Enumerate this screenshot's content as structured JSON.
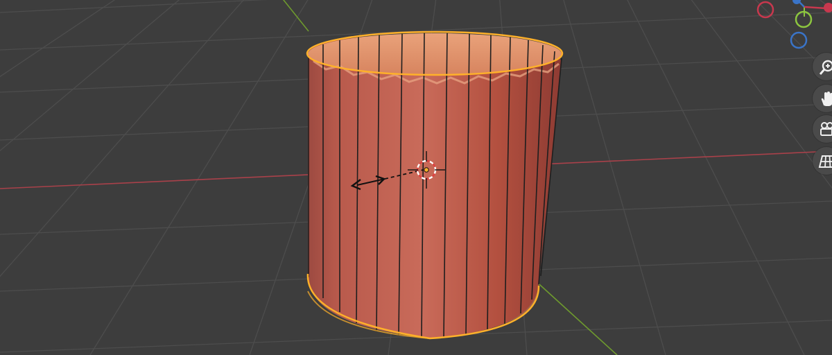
{
  "viewport": {
    "name": "3D Viewport",
    "background": "#3d3d3d",
    "grid_color": "#4f4f4f",
    "x_axis_color": "#b0424b",
    "y_axis_color": "#6f9a2e"
  },
  "object": {
    "type": "cylinder",
    "selected": true,
    "outline_color": "#ffb12a",
    "body_color": "#b8554a",
    "top_color": "#d98a64"
  },
  "transform_gizmo": {
    "mode": "scale"
  },
  "nav_gizmo": {
    "axes": [
      {
        "id": "x-neg",
        "color": "#c8384e"
      },
      {
        "id": "y-neg",
        "color": "#8dc63f"
      },
      {
        "id": "z-neg",
        "color": "#3a74c8"
      }
    ]
  },
  "nav_buttons": [
    {
      "id": "zoom",
      "icon": "zoom-icon"
    },
    {
      "id": "pan",
      "icon": "hand-icon"
    },
    {
      "id": "camera",
      "icon": "camera-icon"
    },
    {
      "id": "perspective",
      "icon": "grid-icon"
    }
  ]
}
